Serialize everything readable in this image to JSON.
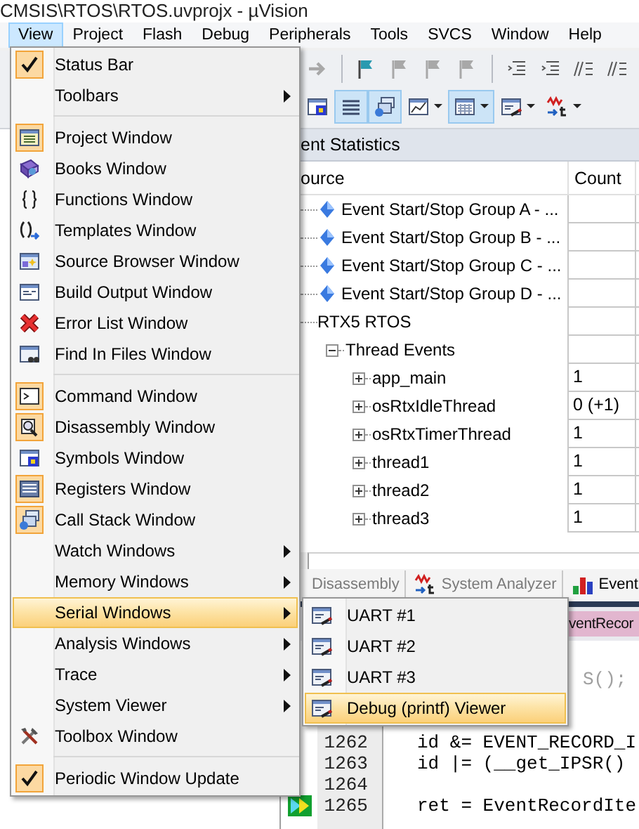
{
  "window": {
    "title": "CMSIS\\RTOS\\RTOS.uvprojx - µVision"
  },
  "menu_bar": [
    {
      "label": "View",
      "selected": true
    },
    {
      "label": "Project",
      "selected": false
    },
    {
      "label": "Flash",
      "selected": false
    },
    {
      "label": "Debug",
      "selected": false
    },
    {
      "label": "Peripherals",
      "selected": false
    },
    {
      "label": "Tools",
      "selected": false
    },
    {
      "label": "SVCS",
      "selected": false
    },
    {
      "label": "Window",
      "selected": false
    },
    {
      "label": "Help",
      "selected": false
    }
  ],
  "toolbar_rows": [
    [
      {
        "kind": "arrow",
        "disabled": true,
        "pressed": false,
        "dropdown": false
      },
      {
        "kind": "separator"
      },
      {
        "kind": "flag",
        "disabled": false,
        "pressed": false,
        "dropdown": false
      },
      {
        "kind": "flag",
        "disabled": true,
        "pressed": false,
        "dropdown": false
      },
      {
        "kind": "flag",
        "disabled": true,
        "pressed": false,
        "dropdown": false
      },
      {
        "kind": "flag",
        "disabled": true,
        "pressed": false,
        "dropdown": false
      },
      {
        "kind": "separator"
      },
      {
        "kind": "indent",
        "disabled": false,
        "pressed": false,
        "dropdown": false
      },
      {
        "kind": "indent",
        "disabled": false,
        "pressed": false,
        "dropdown": false
      },
      {
        "kind": "comment",
        "disabled": false,
        "pressed": false,
        "dropdown": false
      },
      {
        "kind": "comment",
        "disabled": false,
        "pressed": false,
        "dropdown": false
      }
    ],
    [
      {
        "kind": "symbols",
        "pressed": false,
        "dropdown": false
      },
      {
        "kind": "registers",
        "pressed": true,
        "dropdown": false
      },
      {
        "kind": "stack",
        "pressed": true,
        "dropdown": false
      },
      {
        "kind": "window",
        "pressed": false,
        "dropdown": true
      },
      {
        "kind": "memory",
        "pressed": true,
        "dropdown": true
      },
      {
        "kind": "serial",
        "pressed": false,
        "dropdown": true
      },
      {
        "kind": "analyzer",
        "pressed": false,
        "dropdown": true
      }
    ]
  ],
  "event_statistics": {
    "title": "ent Statistics",
    "columns": [
      "ource",
      "Count"
    ],
    "rows": [
      {
        "label": "Event Start/Stop Group A - ...",
        "kind": "group"
      },
      {
        "label": "Event Start/Stop Group B - ...",
        "kind": "group"
      },
      {
        "label": "Event Start/Stop Group C - ...",
        "kind": "group"
      },
      {
        "label": "Event Start/Stop Group D - ...",
        "kind": "group"
      },
      {
        "label": "RTX5 RTOS",
        "kind": "node",
        "children": [
          {
            "label": "Thread Events",
            "kind": "node",
            "expanded": true,
            "children": [
              {
                "label": "app_main",
                "kind": "node",
                "expanded": false,
                "count": "1"
              },
              {
                "label": "osRtxIdleThread",
                "kind": "node",
                "expanded": false,
                "count": "0 (+1)"
              },
              {
                "label": "osRtxTimerThread",
                "kind": "node",
                "expanded": false,
                "count": "1"
              },
              {
                "label": "thread1",
                "kind": "node",
                "expanded": false,
                "count": "1"
              },
              {
                "label": "thread2",
                "kind": "node",
                "expanded": false,
                "count": "1"
              },
              {
                "label": "thread3",
                "kind": "node",
                "expanded": false,
                "count": "1"
              }
            ]
          }
        ]
      }
    ]
  },
  "bottom_tabs": [
    {
      "label": "Disassembly",
      "selected": false
    },
    {
      "label": "System Analyzer",
      "selected": false
    },
    {
      "label": "Event",
      "selected": true
    }
  ],
  "editor": {
    "tab": "ventRecor",
    "lines": [
      {
        "kind": "partial",
        "code": "S();",
        "current": false
      },
      {
        "current": false
      },
      {
        "current": false
      },
      {
        "kind": "code",
        "number": "1262",
        "code": "id &= EVENT_RECORD_I",
        "current": false
      },
      {
        "kind": "code",
        "number": "1263",
        "code": "id |= (__get_IPSR()",
        "current": false
      },
      {
        "number": "1264",
        "current": false
      },
      {
        "kind": "code",
        "number": "1265",
        "code": "ret = EventRecordIte",
        "current": true
      }
    ]
  },
  "view_menu": {
    "items": [
      {
        "kind": "item",
        "label": "Status Bar",
        "checked": true,
        "selected": false
      },
      {
        "kind": "submenu",
        "label": "Toolbars",
        "checked": false,
        "selected": false
      },
      {
        "kind": "separator"
      },
      {
        "kind": "item",
        "label": "Project Window",
        "checked": true,
        "selected": false
      },
      {
        "kind": "item",
        "label": "Books Window",
        "checked": false,
        "selected": false
      },
      {
        "kind": "item",
        "label": "Functions Window",
        "checked": false,
        "selected": false
      },
      {
        "kind": "item",
        "label": "Templates Window",
        "checked": false,
        "selected": false
      },
      {
        "kind": "item",
        "label": "Source Browser Window",
        "checked": false,
        "selected": false
      },
      {
        "kind": "item",
        "label": "Build Output Window",
        "checked": false,
        "selected": false
      },
      {
        "kind": "item",
        "label": "Error List Window",
        "checked": false,
        "selected": false
      },
      {
        "kind": "item",
        "label": "Find In Files Window",
        "checked": false,
        "selected": false
      },
      {
        "kind": "separator"
      },
      {
        "kind": "item",
        "label": "Command Window",
        "checked": true,
        "selected": false
      },
      {
        "kind": "item",
        "label": "Disassembly Window",
        "checked": true,
        "selected": false
      },
      {
        "kind": "item",
        "label": "Symbols Window",
        "checked": false,
        "selected": false
      },
      {
        "kind": "item",
        "label": "Registers Window",
        "checked": true,
        "selected": false
      },
      {
        "kind": "item",
        "label": "Call Stack Window",
        "checked": true,
        "selected": false
      },
      {
        "kind": "submenu",
        "label": "Watch Windows",
        "checked": false,
        "selected": false
      },
      {
        "kind": "submenu",
        "label": "Memory Windows",
        "checked": false,
        "selected": false
      },
      {
        "kind": "submenu",
        "label": "Serial Windows",
        "checked": false,
        "selected": true
      },
      {
        "kind": "submenu",
        "label": "Analysis Windows",
        "checked": false,
        "selected": false
      },
      {
        "kind": "submenu",
        "label": "Trace",
        "checked": false,
        "selected": false
      },
      {
        "kind": "submenu",
        "label": "System Viewer",
        "checked": false,
        "selected": false
      },
      {
        "kind": "item",
        "label": "Toolbox Window",
        "checked": false,
        "selected": false
      },
      {
        "kind": "separator"
      },
      {
        "kind": "item",
        "label": "Periodic Window Update",
        "checked": true,
        "selected": false
      }
    ]
  },
  "serial_submenu": {
    "items": [
      {
        "kind": "item",
        "label": "UART #1",
        "checked": false,
        "selected": false
      },
      {
        "kind": "item",
        "label": "UART #2",
        "checked": false,
        "selected": false
      },
      {
        "kind": "item",
        "label": "UART #3",
        "checked": false,
        "selected": false
      },
      {
        "kind": "item",
        "label": "Debug (printf) Viewer",
        "checked": false,
        "selected": true
      }
    ]
  }
}
